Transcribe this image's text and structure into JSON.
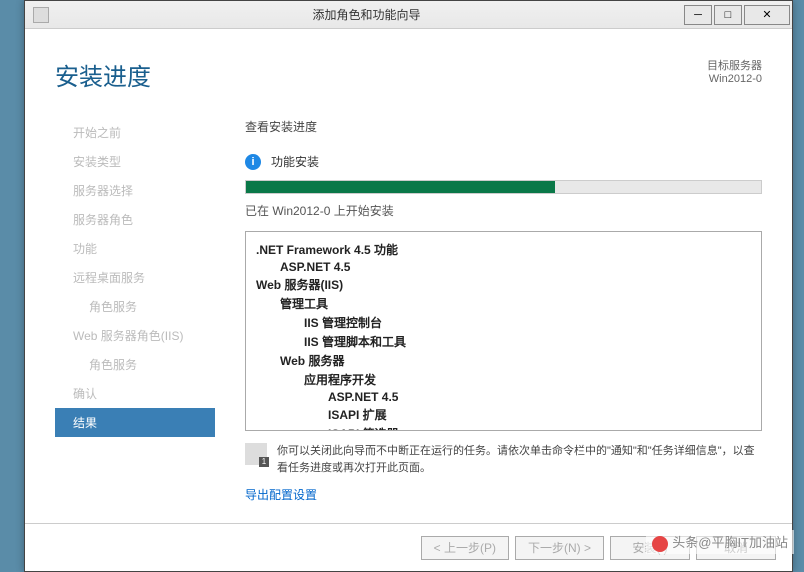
{
  "titlebar": {
    "title": "添加角色和功能向导"
  },
  "header": {
    "page_title": "安装进度",
    "target_label": "目标服务器",
    "target_value": "Win2012-0"
  },
  "sidebar": {
    "items": [
      {
        "label": "开始之前",
        "indent": false
      },
      {
        "label": "安装类型",
        "indent": false
      },
      {
        "label": "服务器选择",
        "indent": false
      },
      {
        "label": "服务器角色",
        "indent": false
      },
      {
        "label": "功能",
        "indent": false
      },
      {
        "label": "远程桌面服务",
        "indent": false
      },
      {
        "label": "角色服务",
        "indent": true
      },
      {
        "label": "Web 服务器角色(IIS)",
        "indent": false
      },
      {
        "label": "角色服务",
        "indent": true
      },
      {
        "label": "确认",
        "indent": false
      },
      {
        "label": "结果",
        "indent": false,
        "active": true
      }
    ]
  },
  "content": {
    "section_title": "查看安装进度",
    "status_text": "功能安装",
    "progress_percent": 60,
    "progress_caption": "已在 Win2012-0 上开始安装",
    "features": [
      {
        "text": ".NET Framework 4.5 功能",
        "level": 0,
        "bold": true
      },
      {
        "text": "ASP.NET 4.5",
        "level": 1,
        "bold": true
      },
      {
        "text": "Web 服务器(IIS)",
        "level": 0,
        "bold": true
      },
      {
        "text": "管理工具",
        "level": 1,
        "bold": true
      },
      {
        "text": "IIS 管理控制台",
        "level": 2,
        "bold": true
      },
      {
        "text": "IIS 管理脚本和工具",
        "level": 2,
        "bold": true
      },
      {
        "text": "Web 服务器",
        "level": 1,
        "bold": true
      },
      {
        "text": "应用程序开发",
        "level": 2,
        "bold": true
      },
      {
        "text": "ASP.NET 4.5",
        "level": 3,
        "bold": true
      },
      {
        "text": "ISAPI 扩展",
        "level": 3,
        "bold": true
      },
      {
        "text": "ISAPI 筛选器",
        "level": 3,
        "bold": true
      }
    ],
    "hint": "你可以关闭此向导而不中断正在运行的任务。请依次单击命令栏中的\"通知\"和\"任务详细信息\"，以查看任务进度或再次打开此页面。",
    "export_link": "导出配置设置"
  },
  "footer": {
    "prev": "< 上一步(P)",
    "next": "下一步(N) >",
    "install": "安装(I)",
    "cancel": "取消"
  },
  "watermark": "头条@平胸IT加油站"
}
